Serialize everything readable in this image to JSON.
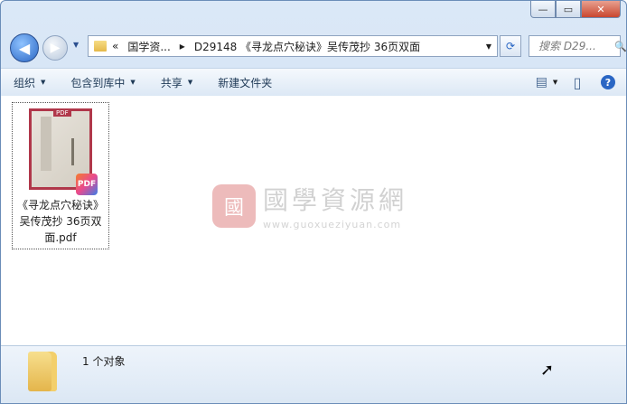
{
  "window": {
    "controls": {
      "minimize": "—",
      "maximize": "▭",
      "close": "✕"
    }
  },
  "nav": {
    "back_glyph": "◀",
    "forward_glyph": "▶",
    "history_glyph": "▼",
    "breadcrumb": {
      "overflow": "«",
      "root": "国学资...",
      "separator": "▸",
      "current": "D29148 《寻龙点穴秘诀》吴传茂抄 36页双面",
      "dropdown": "▼"
    },
    "refresh_glyph": "⟳",
    "search_placeholder": "搜索 D29...",
    "search_icon_glyph": "🔍"
  },
  "toolbar": {
    "organize": "组织",
    "include_in_library": "包含到库中",
    "share": "共享",
    "new_folder": "新建文件夹",
    "arrow": "▼",
    "view_glyph": "▤",
    "view_arrow": "▼",
    "pane_glyph": "▯",
    "help_glyph": "?"
  },
  "files": [
    {
      "name": "《寻龙点穴秘诀》吴传茂抄 36页双面.pdf",
      "name_lines": [
        "《寻龙点穴秘诀》",
        "吴传茂抄 36页双",
        "面.pdf"
      ],
      "thumb_label": "PDF",
      "badge": "PDF"
    }
  ],
  "watermark": {
    "logo_char": "國",
    "cn": "國學資源網",
    "url": "www.guoxueziyuan.com"
  },
  "status": {
    "count_text": "1 个对象"
  },
  "icons": {
    "folder": "folder-icon",
    "pdf": "pdf-icon",
    "search": "search-icon",
    "help": "help-icon"
  },
  "colors": {
    "accent": "#2a66c4",
    "frame": "#6b8db8",
    "close": "#c9472f"
  }
}
